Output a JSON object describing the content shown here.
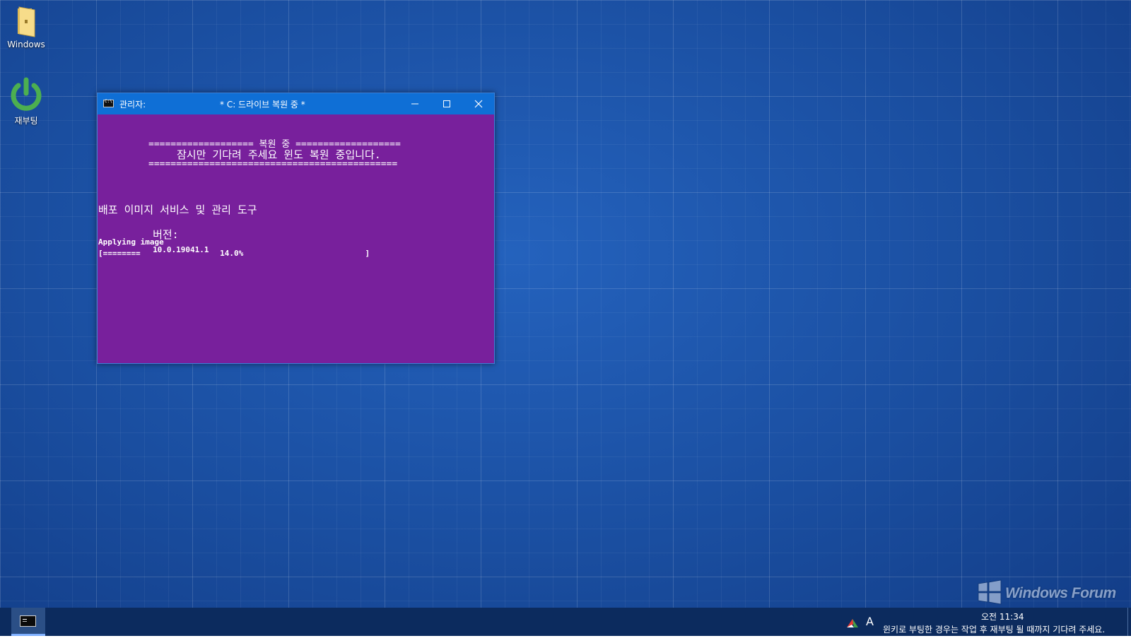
{
  "desktop": {
    "icons": [
      {
        "label": "Windows",
        "icon": "folder-icon"
      },
      {
        "label": "재부팅",
        "icon": "power-icon"
      }
    ]
  },
  "window": {
    "title_left": "관리자:",
    "title_center": "* C: 드라이브 복원 중 *",
    "controls": {
      "minimize": "–",
      "maximize": "☐",
      "close": "✕"
    }
  },
  "console": {
    "banner_top": "=================== 복원 중 ===================",
    "banner_msg": "잠시만 기다려 주세요 윈도 복원 중입니다.",
    "banner_bottom": "=============================================",
    "tool_name": "배포 이미지 서비스 및 관리 도구",
    "version_label": "버전:",
    "version_value": "10.0.19041.1",
    "applying": "Applying image",
    "progress_line": "[========                 14.0%                          ]",
    "progress": 0.14
  },
  "taskbar": {
    "ime": "A",
    "time": "오전 11:34",
    "message": "윈키로 부팅한 경우는 작업 후 재부팅 될 때까지 기다려 주세요."
  },
  "watermark": {
    "text": "Windows Forum"
  },
  "colors": {
    "desktop": "#1a4fa3",
    "console_bg": "#78209c",
    "titlebar": "#0f6fd6",
    "taskbar": "#0c2b5e",
    "power_icon": "#4caf50"
  }
}
